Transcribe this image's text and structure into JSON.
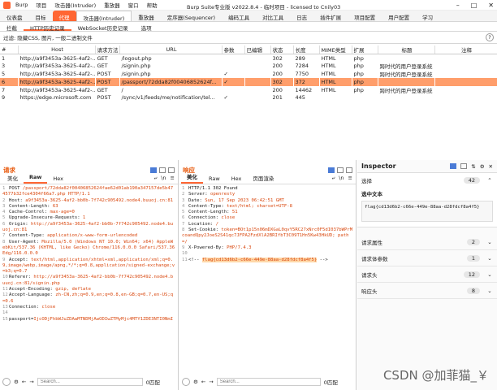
{
  "titlebar": {
    "menu": [
      "Burp",
      "项目",
      "攻击器(Intruder)",
      "重放器",
      "窗口",
      "帮助"
    ],
    "title": "Burp Suite专业版  v2022.8.4 - 临时项目 - licensed to Cnily03",
    "window_controls": [
      "–",
      "□",
      "✕"
    ]
  },
  "main_tabs": [
    "仪表盘",
    "目标",
    "代理",
    "攻击器(Intruder)",
    "重放器",
    "定序器(Sequencer)",
    "编码工具",
    "对比工具",
    "日志",
    "插件扩展",
    "项目配置",
    "用户配置",
    "学习"
  ],
  "sub_tabs": [
    "拦截",
    "HTTP历史记录",
    "WebSocket历史记录",
    "选项"
  ],
  "filter": {
    "text": "过滤: 隐藏CSS, 图片, 一般二进制文件",
    "help": "?"
  },
  "history": {
    "columns": [
      "#",
      "Host",
      "请求方法",
      "URL",
      "参数",
      "已编辑",
      "状态",
      "长度",
      "MIME类型",
      "扩展",
      "标题",
      "注释"
    ],
    "rows": [
      {
        "n": "1",
        "host": "http://a9f3453a-3625-4af2-...",
        "method": "GET",
        "url": "/logout.php",
        "params": "",
        "edited": "",
        "status": "302",
        "length": "289",
        "mime": "HTML",
        "ext": "php",
        "title": "",
        "hl": false
      },
      {
        "n": "3",
        "host": "http://a9f3453a-3625-4af2-...",
        "method": "GET",
        "url": "/signin.php",
        "params": "",
        "edited": "",
        "status": "200",
        "length": "7284",
        "mime": "HTML",
        "ext": "php",
        "title": "跨时代的用户登录系统（占...",
        "hl": false
      },
      {
        "n": "5",
        "host": "http://a9f3453a-3625-4af2-...",
        "method": "POST",
        "url": "/signin.php",
        "params": "✓",
        "edited": "",
        "status": "200",
        "length": "7750",
        "mime": "HTML",
        "ext": "php",
        "title": "跨时代的用户登录系统（占...",
        "hl": false
      },
      {
        "n": "6",
        "host": "http://a9f3453a-3625-4af2-...",
        "method": "POST",
        "url": "/passport/72dda82f00406852624f...",
        "params": "✓",
        "edited": "",
        "status": "302",
        "length": "372",
        "mime": "HTML",
        "ext": "php",
        "title": "",
        "hl": true
      },
      {
        "n": "7",
        "host": "http://a9f3453a-3625-4af2-...",
        "method": "GET",
        "url": "/",
        "params": "",
        "edited": "",
        "status": "200",
        "length": "14462",
        "mime": "HTML",
        "ext": "php",
        "title": "跨时代的用户登录系统（占...",
        "hl": false
      },
      {
        "n": "9",
        "host": "https://edge.microsoft.com",
        "method": "POST",
        "url": "/sync/v1/feeds/me/notification/tel...",
        "params": "✓",
        "edited": "",
        "status": "201",
        "length": "445",
        "mime": "",
        "ext": "",
        "title": "",
        "hl": false
      }
    ]
  },
  "request": {
    "title": "请求",
    "tabs": [
      "美化",
      "Raw",
      "Hex"
    ],
    "search_placeholder": "Search...",
    "matches": "0匹配",
    "lines": [
      {
        "n": "1",
        "k": "POST",
        "v": " /passport/72dda82f00406852624fae62d01ab190a347157de5b474577b32fce4304f66a7.php HTTP/1.1"
      },
      {
        "n": "2",
        "k": "Host:",
        "v": " a9f3453a-3625-4af2-bb0b-7f742c905492.node4.buuoj.cn:81"
      },
      {
        "n": "3",
        "k": "Content-Length:",
        "v": " 63"
      },
      {
        "n": "4",
        "k": "Cache-Control:",
        "v": " max-age=0"
      },
      {
        "n": "5",
        "k": "Upgrade-Insecure-Requests:",
        "v": " 1"
      },
      {
        "n": "6",
        "k": "Origin:",
        "v": " http://a9f3453a-3625-4af2-bb0b-7f742c905492.node4.buuoj.cn:81"
      },
      {
        "n": "7",
        "k": "Content-Type:",
        "v": " application/x-www-form-urlencoded"
      },
      {
        "n": "8",
        "k": "User-Agent:",
        "v": " Mozilla/5.0 (Windows NT 10.0; Win64; x64) AppleWebKit/537.36 (KHTML, like Gecko) Chrome/116.0.0.0 Safari/537.36 Edg/116.0.0.0"
      },
      {
        "n": "9",
        "k": "Accept:",
        "v": " text/html,application/xhtml+xml,application/xml;q=0.9,image/webp,image/apng,*/*;q=0.8,application/signed-exchange;v=b3;q=0.7"
      },
      {
        "n": "10",
        "k": "Referer:",
        "v": " http://a9f3453a-3625-4af2-bb0b-7f742c905492.node4.buuoj.cn:81/signin.php"
      },
      {
        "n": "11",
        "k": "Accept-Encoding:",
        "v": " gzip, deflate"
      },
      {
        "n": "12",
        "k": "Accept-Language:",
        "v": " zh-CN,zh;q=0.9,en;q=0.8,en-GB;q=0.7,en-US;q=0.6"
      },
      {
        "n": "13",
        "k": "Connection:",
        "v": " close"
      },
      {
        "n": "14",
        "k": "",
        "v": ""
      },
      {
        "n": "15",
        "k": "passport=",
        "v": "IjcODjFhbWJuZDAwMTNDMjAwODIwZTMyMjc4MTY1ZDE3NTI0NmI"
      }
    ]
  },
  "response": {
    "title": "响应",
    "tabs": [
      "美化",
      "Raw",
      "Hex",
      "页面渲染"
    ],
    "search_placeholder": "Search...",
    "matches": "0匹配",
    "lines": [
      {
        "n": "1",
        "k": "HTTP/1.1 302 Found",
        "v": ""
      },
      {
        "n": "2",
        "k": "Server:",
        "v": " openresty"
      },
      {
        "n": "3",
        "k": "Date:",
        "v": " Sun, 17 Sep 2023 06:42:51 GMT"
      },
      {
        "n": "4",
        "k": "Content-Type:",
        "v": " text/html; charset=UTF-8"
      },
      {
        "n": "5",
        "k": "Content-Length:",
        "v": " 51"
      },
      {
        "n": "6",
        "k": "Connection:",
        "v": " close"
      },
      {
        "n": "7",
        "k": "Location:",
        "v": " /"
      },
      {
        "n": "8",
        "k": "Set-Cookie:",
        "v": " token=BOt1p15n06mDXGaL0qvY5RC27xNrc0F5dI037bWPrMcoandQpy2JoeS2S41qc7JFPA2FzdXlA2BRIfbT3C09T1Hn5Kw43HkUD; path=/"
      },
      {
        "n": "9",
        "k": "X-Powered-By:",
        "v": " PHP/7.4.3"
      },
      {
        "n": "10",
        "k": "",
        "v": ""
      },
      {
        "n": "11",
        "k": "<!-- ",
        "v": "flag{cd13d6b2-c66e-449e-88aa-d28fdcf8a4f5}",
        "tail": " -->"
      }
    ]
  },
  "inspector": {
    "title": "Inspector",
    "selection_label": "选择",
    "selection_count": "42",
    "selected_text_label": "选中文本",
    "selected_text": "flag{cd13d6b2-c66e-449e-88aa-d28fdcf8a4f5}",
    "sections": [
      {
        "label": "请求属性",
        "count": "2"
      },
      {
        "label": "请求体参数",
        "count": "1"
      },
      {
        "label": "请求头",
        "count": "12"
      },
      {
        "label": "响应头",
        "count": "8"
      }
    ]
  },
  "watermark": "CSDN @加菲猫_￥",
  "colors": {
    "accent": "#ff6633",
    "highlight_row": "#ff9e6b",
    "value_red": "#d9480f"
  }
}
